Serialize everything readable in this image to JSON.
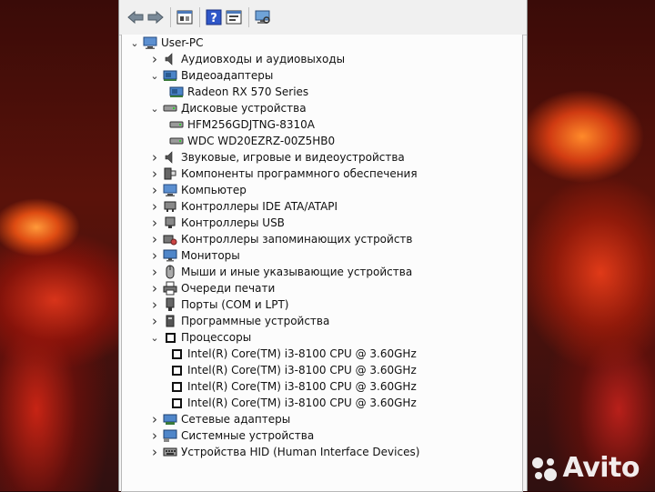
{
  "window": {
    "toolbar": [
      {
        "name": "back-arrow-icon"
      },
      {
        "name": "forward-arrow-icon"
      },
      {
        "name": "properties-icon"
      },
      {
        "name": "help-icon"
      },
      {
        "name": "update-driver-icon"
      },
      {
        "name": "scan-hardware-icon"
      }
    ],
    "tree": {
      "root": "User-PC",
      "items": [
        {
          "label": "Аудиовходы и аудиовыходы",
          "expanded": false,
          "icon": "speaker-icon"
        },
        {
          "label": "Видеоадаптеры",
          "expanded": true,
          "icon": "display-adapter-icon",
          "children": [
            {
              "label": "Radeon RX 570 Series",
              "icon": "display-adapter-icon"
            }
          ]
        },
        {
          "label": "Дисковые устройства",
          "expanded": true,
          "icon": "disk-drive-icon",
          "children": [
            {
              "label": "HFM256GDJTNG-8310A",
              "icon": "disk-drive-icon"
            },
            {
              "label": "WDC WD20EZRZ-00Z5HB0",
              "icon": "disk-drive-icon"
            }
          ]
        },
        {
          "label": "Звуковые, игровые и видеоустройства",
          "expanded": false,
          "icon": "speaker-icon"
        },
        {
          "label": "Компоненты программного обеспечения",
          "expanded": false,
          "icon": "software-component-icon"
        },
        {
          "label": "Компьютер",
          "expanded": false,
          "icon": "computer-icon"
        },
        {
          "label": "Контроллеры IDE ATA/ATAPI",
          "expanded": false,
          "icon": "ide-controller-icon"
        },
        {
          "label": "Контроллеры USB",
          "expanded": false,
          "icon": "usb-controller-icon"
        },
        {
          "label": "Контроллеры запоминающих устройств",
          "expanded": false,
          "icon": "storage-controller-icon"
        },
        {
          "label": "Мониторы",
          "expanded": false,
          "icon": "monitor-icon"
        },
        {
          "label": "Мыши и иные указывающие устройства",
          "expanded": false,
          "icon": "mouse-icon"
        },
        {
          "label": "Очереди печати",
          "expanded": false,
          "icon": "printer-icon"
        },
        {
          "label": "Порты (COM и LPT)",
          "expanded": false,
          "icon": "port-icon"
        },
        {
          "label": "Программные устройства",
          "expanded": false,
          "icon": "software-device-icon"
        },
        {
          "label": "Процессоры",
          "expanded": true,
          "icon": "processor-icon",
          "children": [
            {
              "label": "Intel(R) Core(TM) i3-8100 CPU @ 3.60GHz",
              "icon": "processor-icon"
            },
            {
              "label": "Intel(R) Core(TM) i3-8100 CPU @ 3.60GHz",
              "icon": "processor-icon"
            },
            {
              "label": "Intel(R) Core(TM) i3-8100 CPU @ 3.60GHz",
              "icon": "processor-icon"
            },
            {
              "label": "Intel(R) Core(TM) i3-8100 CPU @ 3.60GHz",
              "icon": "processor-icon"
            }
          ]
        },
        {
          "label": "Сетевые адаптеры",
          "expanded": false,
          "icon": "network-adapter-icon"
        },
        {
          "label": "Системные устройства",
          "expanded": false,
          "icon": "system-device-icon"
        },
        {
          "label": "Устройства HID (Human Interface Devices)",
          "expanded": false,
          "icon": "hid-icon"
        }
      ]
    }
  },
  "watermark": {
    "text": "Avito"
  },
  "colors": {
    "accent": "#2a6fb0",
    "text": "#111111",
    "tree_bg": "#fcfcfc"
  }
}
